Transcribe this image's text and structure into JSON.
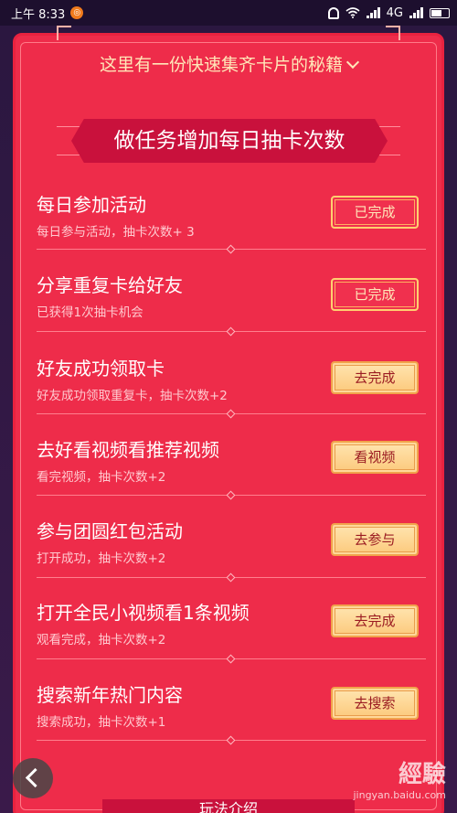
{
  "status_bar": {
    "time": "上午 8:33",
    "network": "4G"
  },
  "header": {
    "secret_link": "这里有一份快速集齐卡片的秘籍",
    "section_title": "做任务增加每日抽卡次数"
  },
  "tasks": [
    {
      "title": "每日参加活动",
      "subtitle": "每日参与活动，抽卡次数+ 3",
      "button": "已完成",
      "state": "done"
    },
    {
      "title": "分享重复卡给好友",
      "subtitle": "已获得1次抽卡机会",
      "button": "已完成",
      "state": "done"
    },
    {
      "title": "好友成功领取卡",
      "subtitle": "好友成功领取重复卡，抽卡次数+2",
      "button": "去完成",
      "state": "todo"
    },
    {
      "title": "去好看视频看推荐视频",
      "subtitle": "看完视频，抽卡次数+2",
      "button": "看视频",
      "state": "todo"
    },
    {
      "title": "参与团圆红包活动",
      "subtitle": "打开成功，抽卡次数+2",
      "button": "去参与",
      "state": "todo"
    },
    {
      "title": "打开全民小视频看1条视频",
      "subtitle": "观看完成，抽卡次数+2",
      "button": "去完成",
      "state": "todo"
    },
    {
      "title": "搜索新年热门内容",
      "subtitle": "搜索成功，抽卡次数+1",
      "button": "去搜索",
      "state": "todo"
    }
  ],
  "footer": {
    "bottom_tab": "玩法介绍",
    "watermark_logo": "經驗",
    "watermark_url": "jingyan.baidu.com"
  },
  "colors": {
    "panel": "#ee2c4a",
    "ribbon": "#c9113c",
    "button_gold": "#fcc97c",
    "button_text": "#9b1c22",
    "done_text": "#ffe6b8"
  },
  "icons": [
    "bell-icon",
    "wifi-icon",
    "signal-icon",
    "battery-icon",
    "chevron-down-icon",
    "back-arrow-icon"
  ]
}
